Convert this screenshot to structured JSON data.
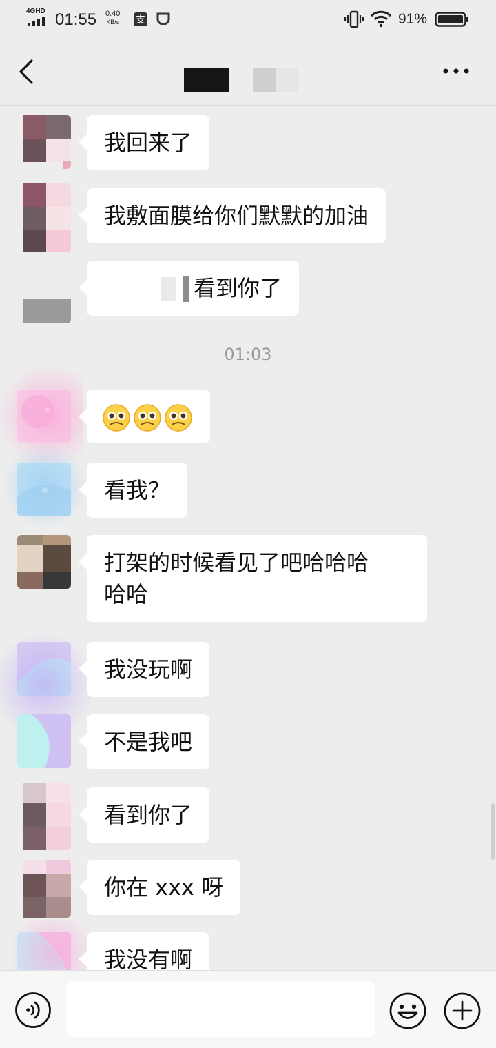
{
  "status_bar": {
    "network": "4GHD",
    "time": "01:55",
    "speed_value": "0.40",
    "speed_unit": "KB/s",
    "battery": "91%"
  },
  "header": {
    "back_icon": "chevron-left-icon",
    "more_icon": "ellipsis-icon"
  },
  "chat": {
    "timestamp": "01:03",
    "messages": [
      {
        "text": "我回来了"
      },
      {
        "text": "我敷面膜给你们默默的加油"
      },
      {
        "text": "看到你了"
      },
      {
        "text": "",
        "emoji": [
          "pleading-face",
          "pleading-face",
          "pleading-face"
        ]
      },
      {
        "text": "看我？"
      },
      {
        "text": "打架的时候看见了吧哈哈哈",
        "text2": "哈哈"
      },
      {
        "text": "我没玩啊"
      },
      {
        "text": "不是我吧"
      },
      {
        "text": "看到你了"
      },
      {
        "text": "你在 xxx 呀"
      },
      {
        "text": "我没有啊"
      }
    ]
  },
  "input_bar": {
    "value": "",
    "voice_icon": "voice-icon",
    "emoji_icon": "smiley-icon",
    "plus_icon": "plus-circle-icon"
  },
  "colors": {
    "background": "#ededed",
    "bubble": "#ffffff",
    "timestamp": "#9a9a9a"
  }
}
